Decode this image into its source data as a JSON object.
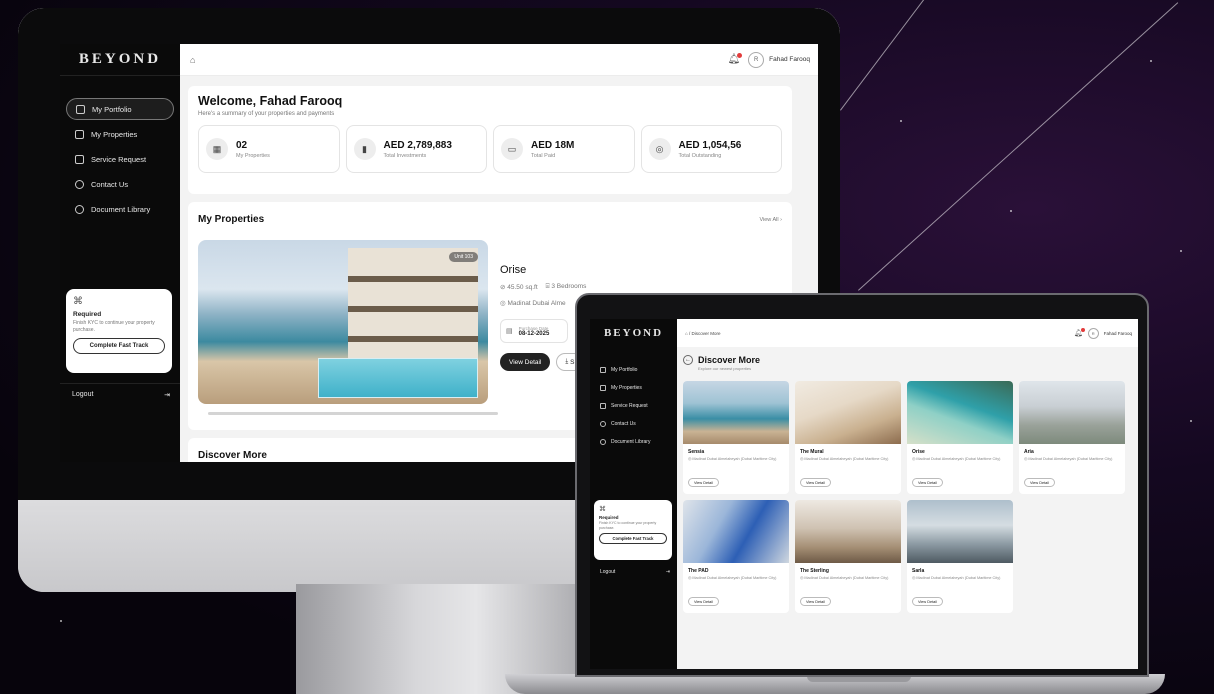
{
  "desktop": {
    "brand": "BEYOND",
    "sidebar": {
      "items": [
        {
          "label": "My Portfolio",
          "active": true
        },
        {
          "label": "My Properties"
        },
        {
          "label": "Service Request"
        },
        {
          "label": "Contact Us"
        },
        {
          "label": "Document Library"
        }
      ],
      "required": {
        "title": "Required",
        "text": "Finish KYC to continue your property purchase.",
        "button": "Complete Fast Track"
      },
      "logout": "Logout"
    },
    "topbar": {
      "user_initial": "R",
      "user_name": "Fahad Farooq"
    },
    "welcome": {
      "title": "Welcome, Fahad Farooq",
      "subtitle": "Here's a summary of your properties and payments",
      "stats": [
        {
          "value": "02",
          "label": "My Properties"
        },
        {
          "value": "AED 2,789,883",
          "label": "Total Investments"
        },
        {
          "value": "AED 18M",
          "label": "Total Paid"
        },
        {
          "value": "AED 1,054,56",
          "label": "Total Outstanding"
        }
      ]
    },
    "properties": {
      "title": "My Properties",
      "view_all": "View All",
      "unit_badge": "Unit 103",
      "name": "Orise",
      "area": "45.50 sq.ft",
      "bedrooms": "3 Bedrooms",
      "location": "Madinat Dubai Alme",
      "purchase_date_label": "Purchase Date",
      "purchase_date": "08-12-2025",
      "view_detail": "View Detail",
      "secondary_btn": "S"
    },
    "discover_title": "Discover More"
  },
  "laptop": {
    "brand": "BEYOND",
    "sidebar": {
      "items": [
        "My Portfolio",
        "My Properties",
        "Service Request",
        "Contact Us",
        "Document Library"
      ],
      "required": {
        "title": "Required",
        "text": "Finish KYC to continue your property purchase.",
        "button": "Complete Fast Track"
      },
      "logout": "Logout"
    },
    "topbar": {
      "breadcrumb": "/ Discover More",
      "user_initial": "R",
      "user_name": "Fahad Farooq"
    },
    "discover": {
      "title": "Discover More",
      "subtitle": "Explore our newest properties",
      "items": [
        {
          "name": "Sensia",
          "location": "Madinat Dubai Almelaheyah (Dubai Maritime City)",
          "button": "View Detail"
        },
        {
          "name": "The Mural",
          "location": "Madinat Dubai Almelaheyah (Dubai Maritime City)",
          "button": "View Detail"
        },
        {
          "name": "Orise",
          "location": "Madinat Dubai Almelaheyah (Dubai Maritime City)",
          "button": "View Detail"
        },
        {
          "name": "Aria",
          "location": "Madinat Dubai Almelaheyah (Dubai Maritime City)",
          "button": "View Detail"
        },
        {
          "name": "The PAD",
          "location": "Madinat Dubai Almelaheyah (Dubai Maritime City)",
          "button": "View Detail"
        },
        {
          "name": "The Sterling",
          "location": "Madinat Dubai Almelaheyah (Dubai Maritime City)",
          "button": "View Detail"
        },
        {
          "name": "Sarla",
          "location": "Madinat Dubai Almelaheyah (Dubai Maritime City)",
          "button": "View Detail"
        }
      ]
    }
  }
}
